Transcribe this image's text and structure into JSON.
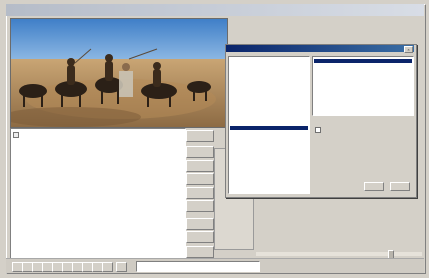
{
  "main_window": {
    "title": "",
    "side_buttons": [
      "",
      "",
      "",
      "",
      "",
      "",
      "",
      "",
      ""
    ],
    "capture_list": {
      "lines": [
        "",
        "",
        ""
      ]
    },
    "status_text": ""
  },
  "dialog": {
    "title": "",
    "tree_items": [
      "",
      "",
      "",
      "",
      "",
      "",
      "",
      "",
      "",
      "",
      "",
      "",
      "",
      "",
      "",
      "",
      "",
      "",
      "",
      "",
      ""
    ],
    "selected_tree_index": 15,
    "formats": [
      {
        "res": "",
        "size": ""
      },
      {
        "res": "",
        "size": ""
      },
      {
        "res": "",
        "size": ""
      },
      {
        "res": "",
        "size": ""
      },
      {
        "res": "",
        "size": ""
      },
      {
        "res": "",
        "size": ""
      },
      {
        "res": "",
        "size": ""
      },
      {
        "res": "",
        "size": ""
      },
      {
        "res": "",
        "size": ""
      },
      {
        "res": "",
        "size": ""
      },
      {
        "res": "",
        "size": ""
      },
      {
        "res": "",
        "size": ""
      },
      {
        "res": "",
        "size": ""
      }
    ],
    "selected_format_index": 0,
    "checkbox_label": "",
    "info_labels": [
      "",
      "",
      "",
      "",
      ""
    ],
    "info_values": [
      "",
      "",
      "",
      "",
      ""
    ],
    "ok_label": "",
    "cancel_label": ""
  },
  "colors": {
    "selection": "#0a246a",
    "face": "#d4d0c8"
  }
}
